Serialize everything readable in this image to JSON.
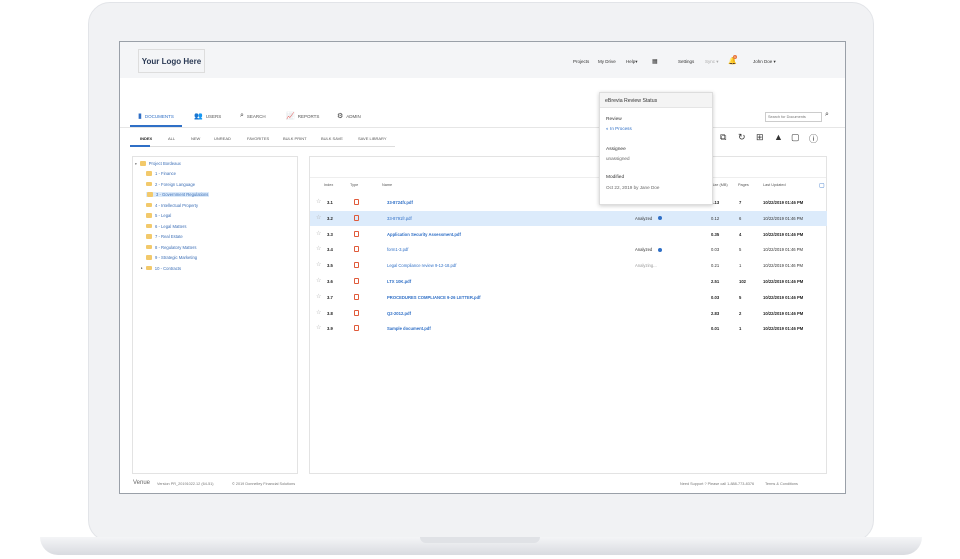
{
  "header": {
    "logo": "Your Logo Here",
    "links": [
      "Projects",
      "My Drive",
      "Help▾"
    ],
    "settings": "Settings",
    "sync": "Sync ▾",
    "notification_count": "1",
    "user": "John Doe ▾"
  },
  "nav": {
    "tabs": [
      {
        "label": "DOCUMENTS",
        "icon": "documents-icon",
        "active": true
      },
      {
        "label": "USERS",
        "icon": "users-icon"
      },
      {
        "label": "SEARCH",
        "icon": "search-icon"
      },
      {
        "label": "REPORTS",
        "icon": "reports-icon"
      },
      {
        "label": "ADMIN",
        "icon": "gear-icon"
      }
    ],
    "search_placeholder": "Search for Documents"
  },
  "subtabs": [
    "INDEX",
    "ALL",
    "NEW",
    "UNREAD",
    "FAVORITES",
    "BULK PRINT",
    "BULK SAVE",
    "SAVE LIBRARY"
  ],
  "tree": {
    "root": "Project Bordeaux",
    "children": [
      "1 - Finance",
      "2 - Foreign Language",
      "3 - Government Regulations",
      "4 - Intellectual Property",
      "5 - Legal",
      "6 - Legal Matters",
      "7 - Real Estate",
      "8 - Regulatory Matters",
      "9 - Strategic Marketing",
      "10 - Contracts"
    ],
    "selected": "3 - Government Regulations"
  },
  "table": {
    "columns": [
      "Index",
      "Type",
      "Name",
      "Size (MB)",
      "Pages",
      "Last Updated"
    ],
    "rows": [
      {
        "index": "3.1",
        "name": "33-8724fr.pdf",
        "status": "",
        "size": "3.13",
        "pages": "7",
        "updated": "10/22/2019 01:46 PM",
        "bold": true
      },
      {
        "index": "3.2",
        "name": "33-8791fr.pdf",
        "status": "Analyzed",
        "size": "0.12",
        "pages": "6",
        "updated": "10/22/2019 01:46 PM",
        "bold": false,
        "selected": true
      },
      {
        "index": "3.3",
        "name": "Application Security Assessment.pdf",
        "status": "",
        "size": "0.35",
        "pages": "4",
        "updated": "10/22/2019 01:46 PM",
        "bold": true
      },
      {
        "index": "3.4",
        "name": "form1-3.pdf",
        "status": "Analyzed",
        "size": "0.03",
        "pages": "5",
        "updated": "10/22/2019 01:46 PM",
        "bold": false
      },
      {
        "index": "3.5",
        "name": "Legal Compliance review 9-12-18.pdf",
        "status": "Analyzing...",
        "size": "0.21",
        "pages": "1",
        "updated": "10/22/2019 01:46 PM",
        "bold": false
      },
      {
        "index": "3.6",
        "name": "LTX 10K.pdf",
        "status": "",
        "size": "2.51",
        "pages": "102",
        "updated": "10/22/2019 01:46 PM",
        "bold": true
      },
      {
        "index": "3.7",
        "name": "PROCEDURES COMPLIANCE 9-26 LETTER.pdf",
        "status": "",
        "size": "0.03",
        "pages": "5",
        "updated": "10/22/2019 01:46 PM",
        "bold": true
      },
      {
        "index": "3.8",
        "name": "Q2-2012.pdf",
        "status": "",
        "size": "2.83",
        "pages": "2",
        "updated": "10/22/2019 01:46 PM",
        "bold": true
      },
      {
        "index": "3.9",
        "name": "Sample document.pdf",
        "status": "",
        "size": "0.01",
        "pages": "1",
        "updated": "10/22/2019 01:46 PM",
        "bold": true
      }
    ]
  },
  "popup": {
    "title": "eBrevia Review Status",
    "review_label": "Review",
    "review_value": "In Process",
    "assignee_label": "Assignee",
    "assignee_value": "unassigned",
    "modified_label": "Modified",
    "modified_value": "Oct 22, 2019 by Jane Doe"
  },
  "footer": {
    "brand": "Venue",
    "version": "Version PR_20191022.12 (64-51)",
    "copyright": "© 2019 Donnelley Financial Solutions",
    "support": "Need Support ? Please call 1-888-773-8376",
    "terms": "Terms & Conditions"
  },
  "colors": {
    "accent": "#2f6fc6",
    "selected_row": "#dcebfb",
    "pdf": "#e05a3a",
    "folder": "#f2c96b"
  }
}
